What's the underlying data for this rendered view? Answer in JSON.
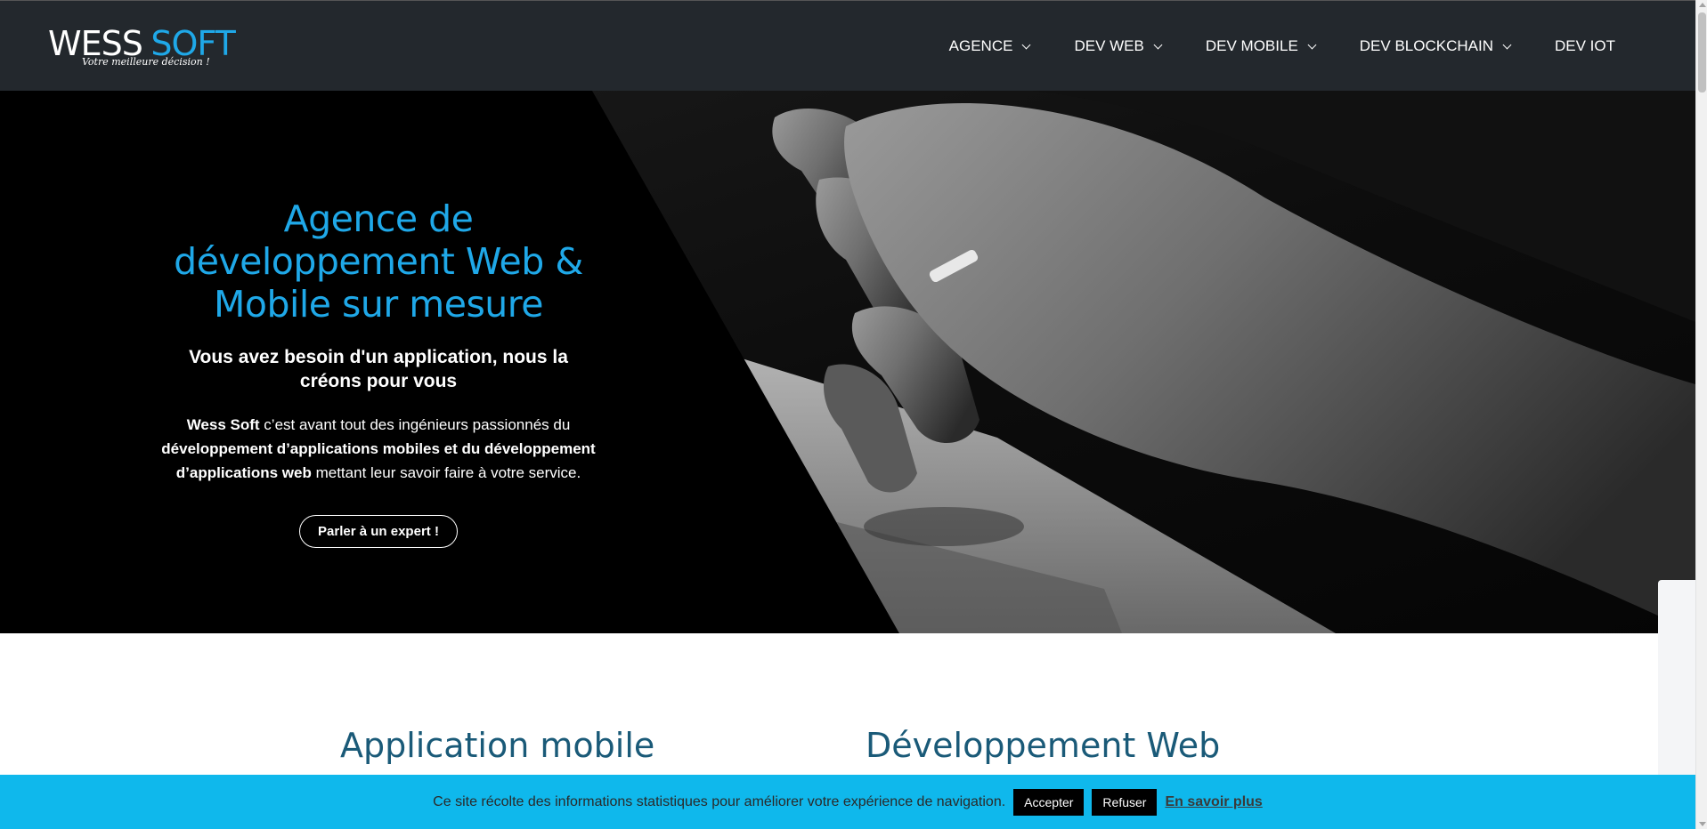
{
  "header": {
    "logo": {
      "primary": "WESS",
      "secondary": "SOFT",
      "tagline": "Votre meilleure décision !"
    },
    "nav": [
      {
        "label": "AGENCE",
        "has_dropdown": true
      },
      {
        "label": "DEV WEB",
        "has_dropdown": true
      },
      {
        "label": "DEV MOBILE",
        "has_dropdown": true
      },
      {
        "label": "DEV BLOCKCHAIN",
        "has_dropdown": true
      },
      {
        "label": "DEV IOT",
        "has_dropdown": false
      }
    ]
  },
  "hero": {
    "title": "Agence de développement Web & Mobile sur mesure",
    "subtitle": "Vous avez besoin d'un application, nous la créons pour vous",
    "text": {
      "brand": "Wess Soft",
      "part1": " c’est avant tout des ingénieurs passionnés du ",
      "highlight1": "développement d’applications mobiles et du développement d’applications web",
      "part2": " mettant leur savoir faire à votre service."
    },
    "cta_label": "Parler à un expert !"
  },
  "sections": {
    "mobile_title": "Application mobile",
    "web_title": "Développement Web"
  },
  "cookie": {
    "text": "Ce site récolte des informations statistiques pour améliorer votre expérience de navigation.",
    "accept_label": "Accepter",
    "refuse_label": "Refuser",
    "more_label": "En savoir plus"
  },
  "colors": {
    "header_bg": "#23282d",
    "accent": "#1fa8e8",
    "section_title": "#1a5a78",
    "cookie_bg": "#0fb8ec"
  }
}
